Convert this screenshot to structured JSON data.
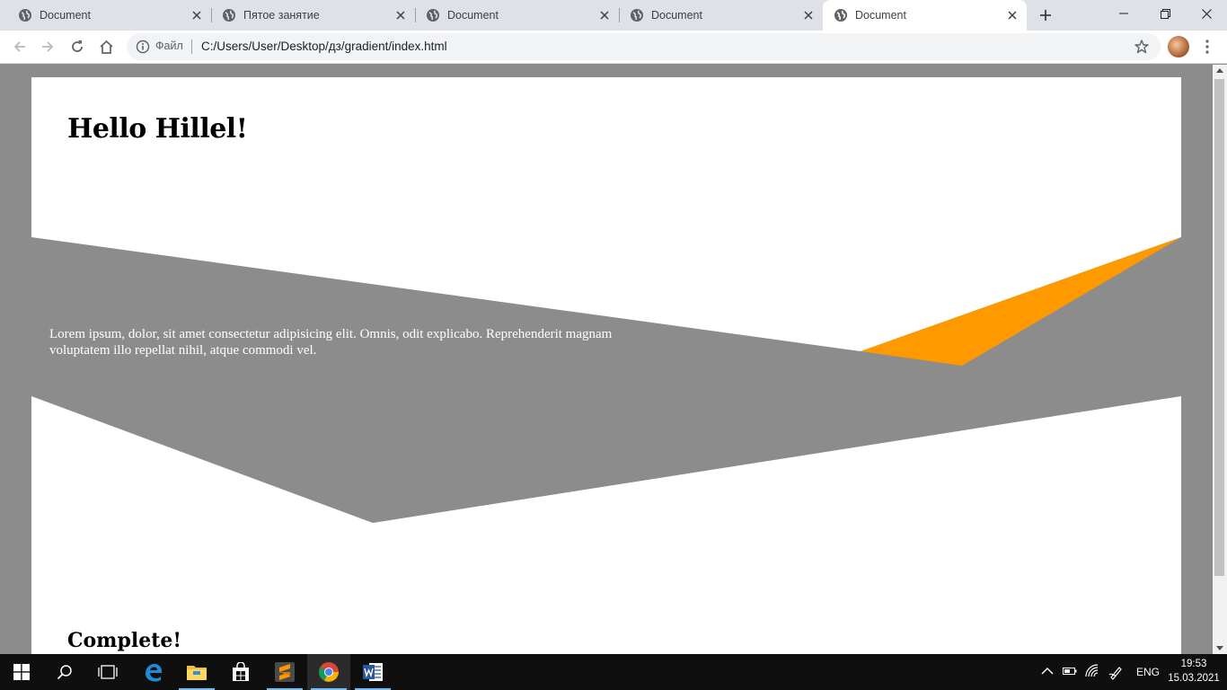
{
  "browser": {
    "tabs": [
      {
        "title": "Document",
        "active": false
      },
      {
        "title": "Пятое занятие",
        "active": false
      },
      {
        "title": "Document",
        "active": false
      },
      {
        "title": "Document",
        "active": false
      },
      {
        "title": "Document",
        "active": true
      }
    ],
    "address": {
      "scheme_label": "Файл",
      "url": "C:/Users/User/Desktop/дз/gradient/index.html"
    }
  },
  "page": {
    "heading": "Hello Hillel!",
    "paragraph": "Lorem ipsum, dolor, sit amet consectetur adipisicing elit. Omnis, odit explicabo. Reprehenderit magnam voluptatem illo repellat nihil, atque commodi vel.",
    "footer_heading": "Complete!"
  },
  "colors": {
    "page_background": "#8c8c8c",
    "card_background": "#ffffff",
    "accent": "#ff9900"
  },
  "taskbar": {
    "language": "ENG",
    "time": "19:53",
    "date": "15.03.2021",
    "apps": [
      "start-icon",
      "search-icon",
      "task-view-icon",
      "edge-icon",
      "file-explorer-icon",
      "store-icon",
      "sublime-text-icon",
      "chrome-icon",
      "word-icon"
    ]
  }
}
